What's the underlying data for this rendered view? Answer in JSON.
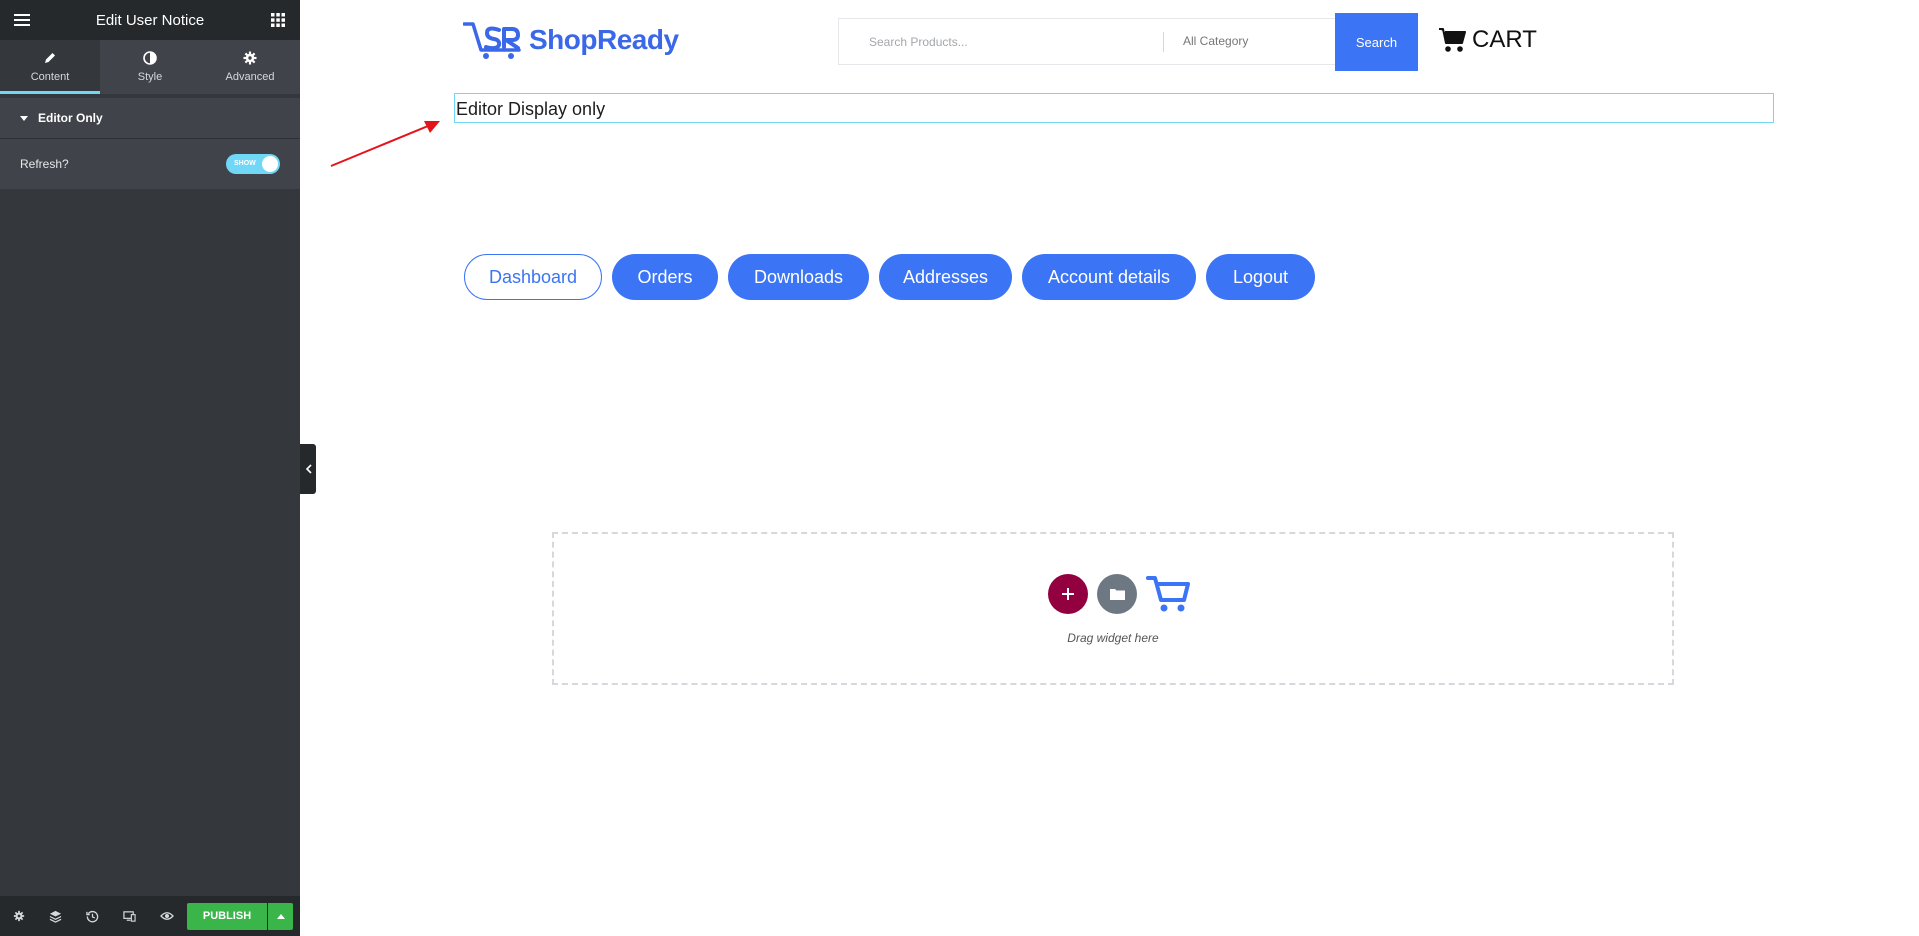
{
  "editor": {
    "title": "Edit User Notice",
    "menu_icon": "hamburger-icon",
    "widgets_icon": "grid-icon",
    "tabs": [
      {
        "label": "Content",
        "icon": "pencil-icon"
      },
      {
        "label": "Style",
        "icon": "half-circle-icon"
      },
      {
        "label": "Advanced",
        "icon": "gear-icon"
      }
    ],
    "section": {
      "title": "Editor Only"
    },
    "control": {
      "label": "Refresh?",
      "toggle_text": "SHOW",
      "toggle_on": true
    },
    "footer": {
      "icons": [
        "settings-icon",
        "layers-icon",
        "history-icon",
        "responsive-icon",
        "preview-eye-icon"
      ],
      "publish_label": "PUBLISH"
    },
    "accent_color": "#71d7f7",
    "publish_color": "#39b54a"
  },
  "site": {
    "logo_text": "ShopReady",
    "search": {
      "placeholder": "Search Products...",
      "category": "All Category",
      "button": "Search"
    },
    "cart_label": "CART",
    "notice_text": "Editor Display only",
    "account_nav": [
      {
        "label": "Dashboard",
        "active": true
      },
      {
        "label": "Orders",
        "active": false
      },
      {
        "label": "Downloads",
        "active": false
      },
      {
        "label": "Addresses",
        "active": false
      },
      {
        "label": "Account details",
        "active": false
      },
      {
        "label": "Logout",
        "active": false
      }
    ],
    "dropzone_text": "Drag widget here",
    "brand_color": "#3b74f5"
  }
}
